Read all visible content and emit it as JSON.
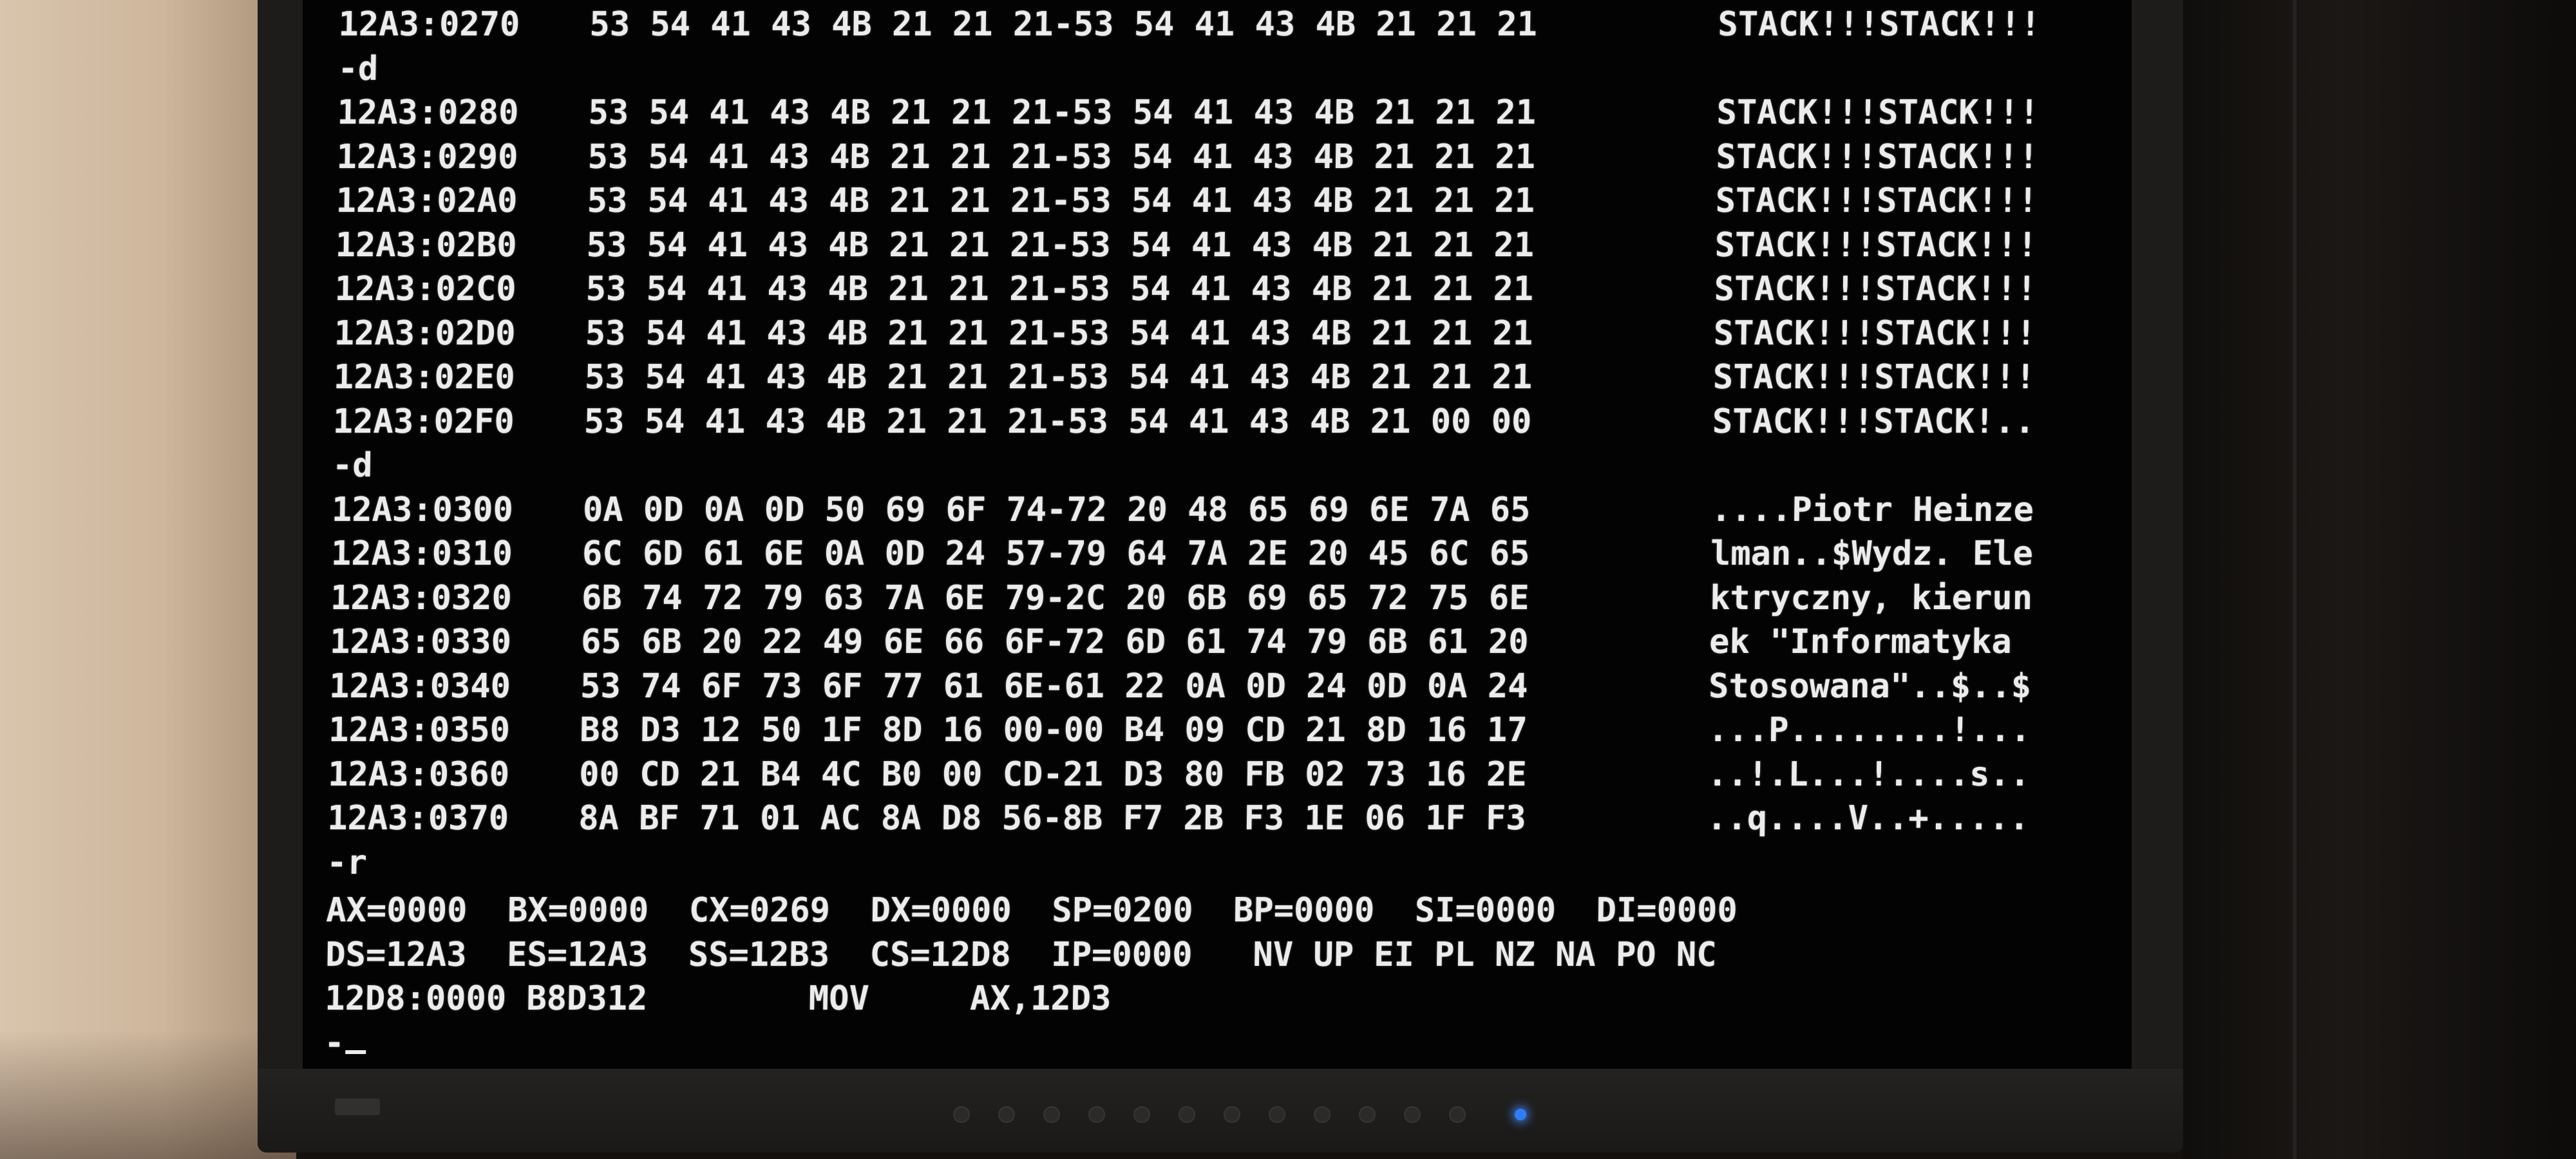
{
  "dump1": {
    "first_line": {
      "addr": "12A3:0270",
      "hex": "53 54 41 43 4B 21 21 21-53 54 41 43 4B 21 21 21",
      "ascii": "STACK!!!STACK!!!"
    },
    "command": "-d",
    "rows": [
      {
        "addr": "12A3:0280",
        "hex": "53 54 41 43 4B 21 21 21-53 54 41 43 4B 21 21 21",
        "ascii": "STACK!!!STACK!!!"
      },
      {
        "addr": "12A3:0290",
        "hex": "53 54 41 43 4B 21 21 21-53 54 41 43 4B 21 21 21",
        "ascii": "STACK!!!STACK!!!"
      },
      {
        "addr": "12A3:02A0",
        "hex": "53 54 41 43 4B 21 21 21-53 54 41 43 4B 21 21 21",
        "ascii": "STACK!!!STACK!!!"
      },
      {
        "addr": "12A3:02B0",
        "hex": "53 54 41 43 4B 21 21 21-53 54 41 43 4B 21 21 21",
        "ascii": "STACK!!!STACK!!!"
      },
      {
        "addr": "12A3:02C0",
        "hex": "53 54 41 43 4B 21 21 21-53 54 41 43 4B 21 21 21",
        "ascii": "STACK!!!STACK!!!"
      },
      {
        "addr": "12A3:02D0",
        "hex": "53 54 41 43 4B 21 21 21-53 54 41 43 4B 21 21 21",
        "ascii": "STACK!!!STACK!!!"
      },
      {
        "addr": "12A3:02E0",
        "hex": "53 54 41 43 4B 21 21 21-53 54 41 43 4B 21 21 21",
        "ascii": "STACK!!!STACK!!!"
      },
      {
        "addr": "12A3:02F0",
        "hex": "53 54 41 43 4B 21 21 21-53 54 41 43 4B 21 00 00",
        "ascii": "STACK!!!STACK!.."
      }
    ]
  },
  "dump2": {
    "command": "-d",
    "rows": [
      {
        "addr": "12A3:0300",
        "hex": "0A 0D 0A 0D 50 69 6F 74-72 20 48 65 69 6E 7A 65",
        "ascii": "....Piotr Heinze"
      },
      {
        "addr": "12A3:0310",
        "hex": "6C 6D 61 6E 0A 0D 24 57-79 64 7A 2E 20 45 6C 65",
        "ascii": "lman..$Wydz. Ele"
      },
      {
        "addr": "12A3:0320",
        "hex": "6B 74 72 79 63 7A 6E 79-2C 20 6B 69 65 72 75 6E",
        "ascii": "ktryczny, kierun"
      },
      {
        "addr": "12A3:0330",
        "hex": "65 6B 20 22 49 6E 66 6F-72 6D 61 74 79 6B 61 20",
        "ascii": "ek \"Informatyka "
      },
      {
        "addr": "12A3:0340",
        "hex": "53 74 6F 73 6F 77 61 6E-61 22 0A 0D 24 0D 0A 24",
        "ascii": "Stosowana\"..$..$"
      },
      {
        "addr": "12A3:0350",
        "hex": "B8 D3 12 50 1F 8D 16 00-00 B4 09 CD 21 8D 16 17",
        "ascii": "...P........!..."
      },
      {
        "addr": "12A3:0360",
        "hex": "00 CD 21 B4 4C B0 00 CD-21 D3 80 FB 02 73 16 2E",
        "ascii": "..!.L...!....s.."
      },
      {
        "addr": "12A3:0370",
        "hex": "8A BF 71 01 AC 8A D8 56-8B F7 2B F3 1E 06 1F F3",
        "ascii": "..q....V..+....."
      }
    ]
  },
  "registers": {
    "command": "-r",
    "line1": "AX=0000  BX=0000  CX=0269  DX=0000  SP=0200  BP=0000  SI=0000  DI=0000",
    "line2": "DS=12A3  ES=12A3  SS=12B3  CS=12D8  IP=0000   NV UP EI PL NZ NA PO NC",
    "line3": "12D8:0000 B8D312        MOV     AX,12D3"
  },
  "prompt": "-"
}
